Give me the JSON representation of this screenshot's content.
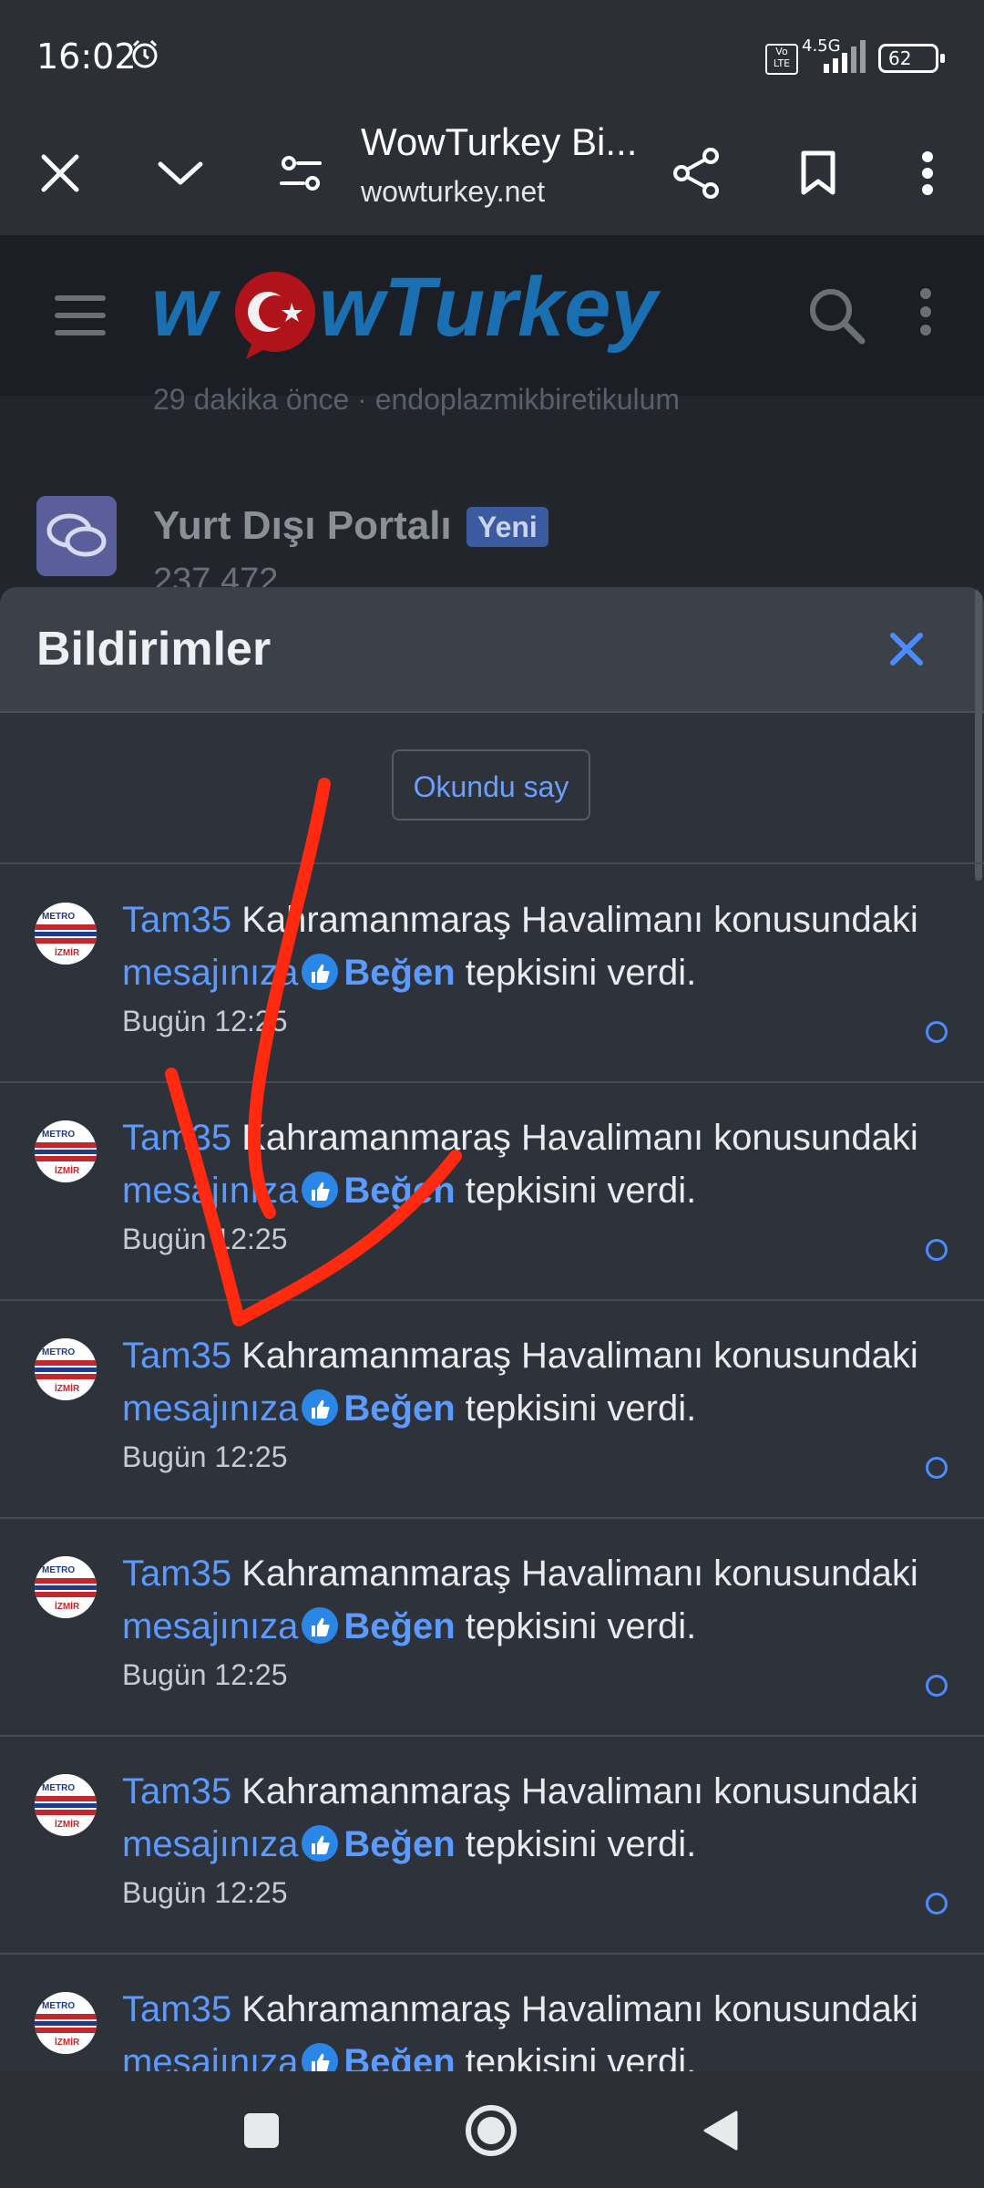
{
  "status_bar": {
    "time": "16:02",
    "volte": "Vo LTE",
    "network": "4.5G",
    "battery": "62"
  },
  "browser": {
    "title": "WowTurkey Bi...",
    "url": "wowturkey.net"
  },
  "site": {
    "logo_text": "wowTurkey",
    "behind_line": "29 dakika önce · endoplazmikbiretikulum",
    "forum_title": "Yurt Dışı Portalı",
    "forum_badge": "Yeni",
    "forum_stats": "237   472"
  },
  "notifications_panel": {
    "title": "Bildirimler",
    "mark_read": "Okundu say",
    "items": [
      {
        "user": "Tam35",
        "text_mid": "Kahramanmaraş Havalimanı konusundaki",
        "msg": "mesajınıza",
        "reaction": "Beğen",
        "text_end": "tepkisini verdi.",
        "time": "Bugün 12:25"
      },
      {
        "user": "Tam35",
        "text_mid": "Kahramanmaraş Havalimanı konusundaki",
        "msg": "mesajınıza",
        "reaction": "Beğen",
        "text_end": "tepkisini verdi.",
        "time": "Bugün 12:25"
      },
      {
        "user": "Tam35",
        "text_mid": "Kahramanmaraş Havalimanı konusundaki",
        "msg": "mesajınıza",
        "reaction": "Beğen",
        "text_end": "tepkisini verdi.",
        "time": "Bugün 12:25"
      },
      {
        "user": "Tam35",
        "text_mid": "Kahramanmaraş Havalimanı konusundaki",
        "msg": "mesajınıza",
        "reaction": "Beğen",
        "text_end": "tepkisini verdi.",
        "time": "Bugün 12:25"
      },
      {
        "user": "Tam35",
        "text_mid": "Kahramanmaraş Havalimanı konusundaki",
        "msg": "mesajınıza",
        "reaction": "Beğen",
        "text_end": "tepkisini verdi.",
        "time": "Bugün 12:25"
      },
      {
        "user": "Tam35",
        "text_mid": "Kahramanmaraş Havalimanı konusundaki",
        "msg": "mesajınıza",
        "reaction": "Beğen",
        "text_end": "tepkisini verdi.",
        "time": ""
      }
    ]
  },
  "colors": {
    "accent": "#4a8cff",
    "annotation": "#ff2a10",
    "panel_bg": "#2e323b"
  }
}
